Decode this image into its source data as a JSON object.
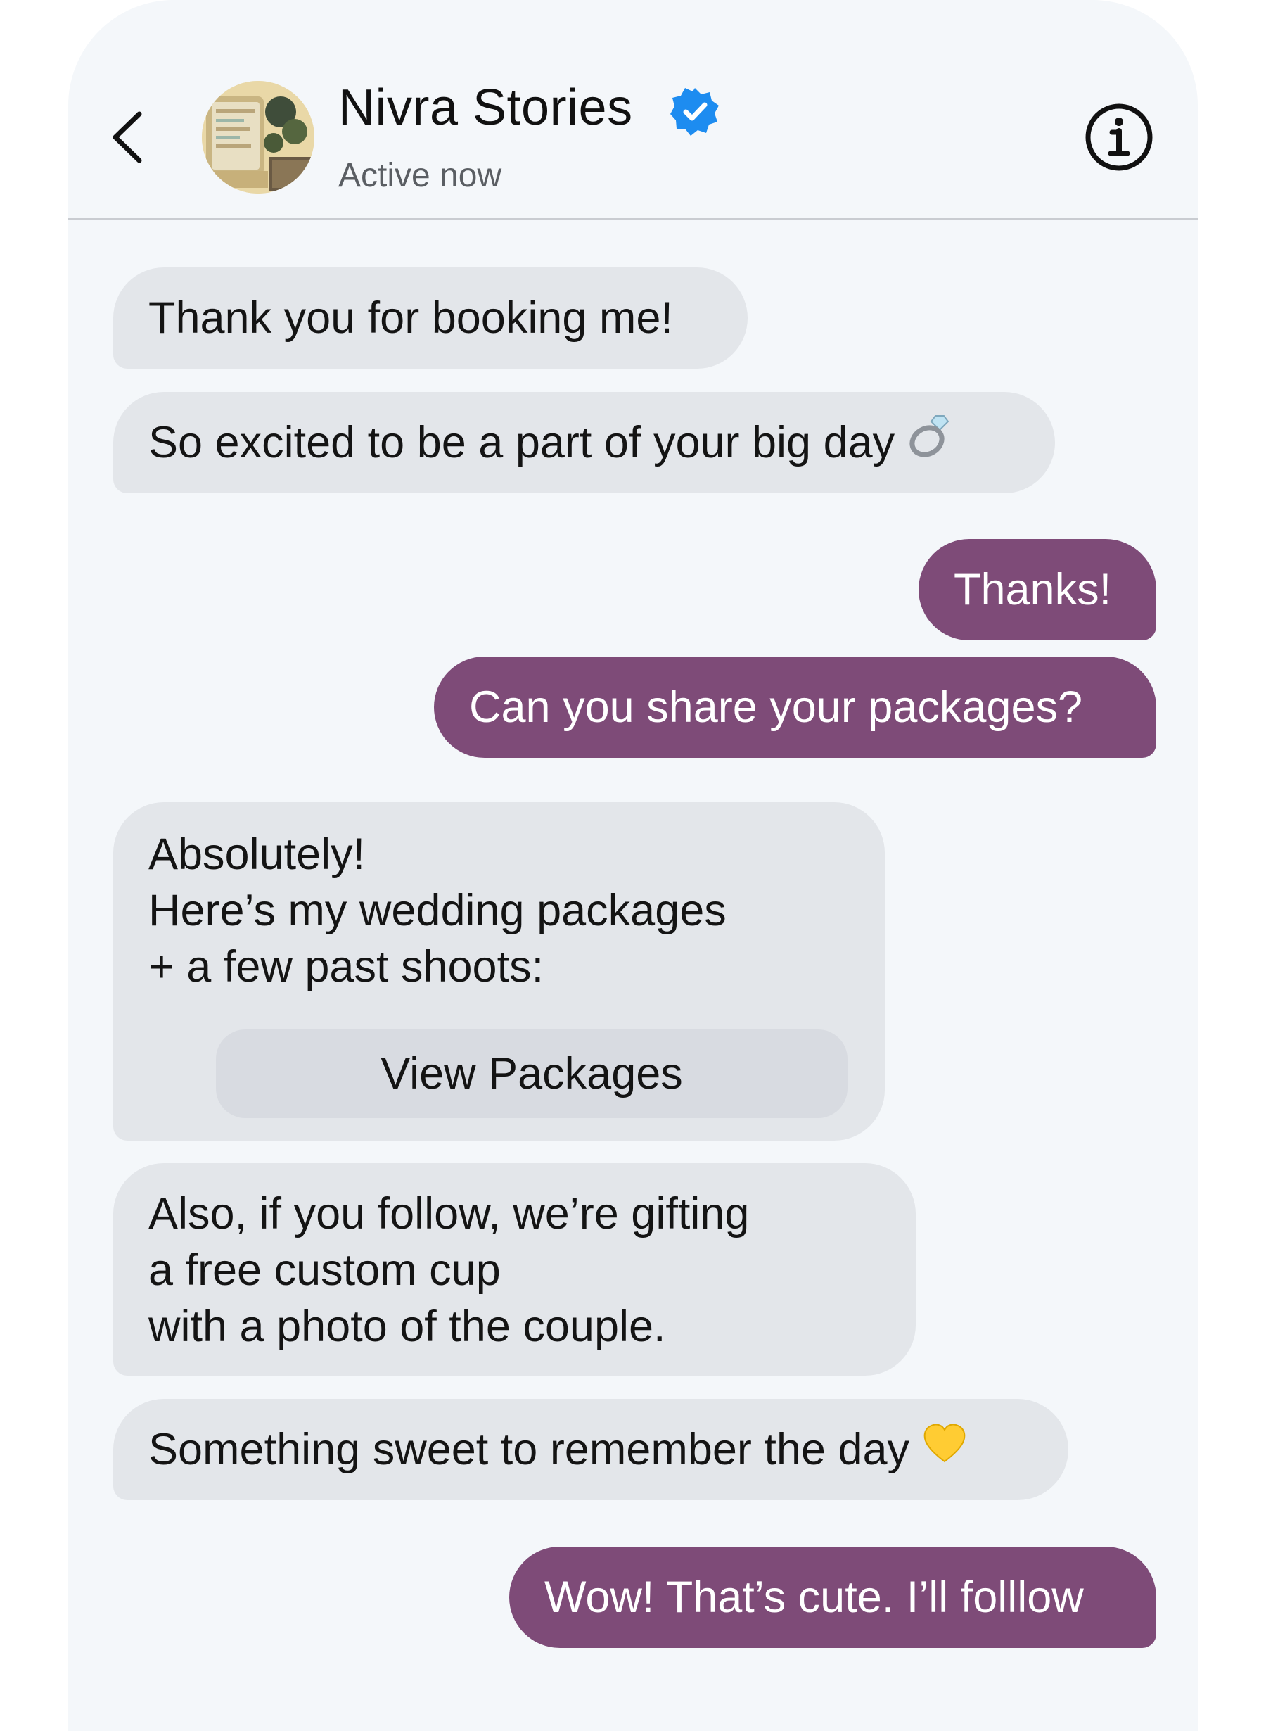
{
  "header": {
    "contact_name": "Nivra Stories",
    "status": "Active now",
    "verified_icon": "verified-badge-icon",
    "back_icon": "chevron-left-icon",
    "info_icon": "info-icon"
  },
  "messages": [
    {
      "from": "them",
      "text": "Thank you for booking me!"
    },
    {
      "from": "them",
      "text": "So excited to be a part of your big day",
      "emoji": "ring"
    },
    {
      "from": "me",
      "text": "Thanks!"
    },
    {
      "from": "me",
      "text": "Can you share your packages?"
    },
    {
      "from": "them",
      "lines": [
        "Absolutely!",
        "Here’s my wedding packages",
        "+ a few past shoots:"
      ],
      "button_label": "View Packages"
    },
    {
      "from": "them",
      "lines": [
        "Also, if you follow, we’re gifting",
        "a free custom cup",
        "with a photo of the couple."
      ]
    },
    {
      "from": "them",
      "text": "Something sweet to remember the day",
      "emoji": "yellow-heart"
    },
    {
      "from": "me",
      "text": "Wow! That’s cute. I’ll folllow"
    }
  ],
  "colors": {
    "incoming_bubble": "#e3e6ea",
    "outgoing_bubble": "#7e4b78",
    "background": "#f4f7fa",
    "verified": "#1d8cf0"
  }
}
